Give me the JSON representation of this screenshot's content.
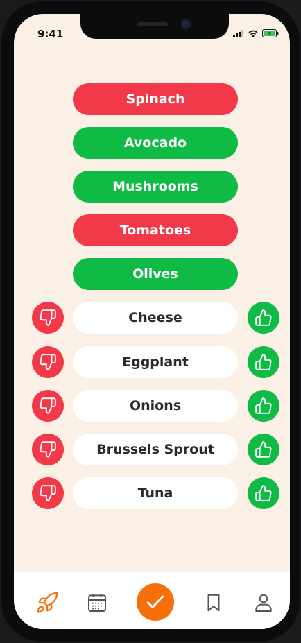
{
  "status_bar": {
    "time": "9:41"
  },
  "food_list": [
    {
      "name": "Spinach",
      "state": "disliked"
    },
    {
      "name": "Avocado",
      "state": "liked"
    },
    {
      "name": "Mushrooms",
      "state": "liked"
    },
    {
      "name": "Tomatoes",
      "state": "disliked"
    },
    {
      "name": "Olives",
      "state": "liked"
    },
    {
      "name": "Cheese",
      "state": "unrated"
    },
    {
      "name": "Eggplant",
      "state": "unrated"
    },
    {
      "name": "Onions",
      "state": "unrated"
    },
    {
      "name": "Brussels Sprout",
      "state": "unrated"
    },
    {
      "name": "Tuna",
      "state": "unrated"
    }
  ],
  "vote_buttons": {
    "dislike_icon": "thumbs-down-icon",
    "like_icon": "thumbs-up-icon"
  },
  "tab_bar": {
    "items": [
      {
        "icon": "rocket-icon",
        "active": true
      },
      {
        "icon": "calendar-icon",
        "active": false
      },
      {
        "icon": "checkmark-icon",
        "active": false
      },
      {
        "icon": "bookmark-icon",
        "active": false
      },
      {
        "icon": "profile-icon",
        "active": false
      }
    ]
  },
  "colors": {
    "like": "#10bb45",
    "dislike": "#f2394a",
    "accent": "#f5700a",
    "background": "#fbf0e5"
  }
}
